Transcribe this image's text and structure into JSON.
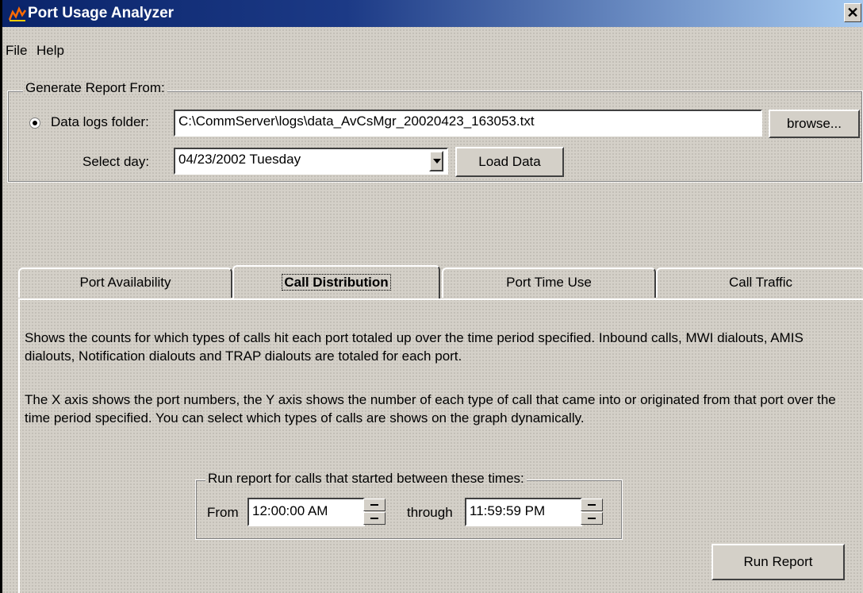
{
  "window": {
    "title": "Port Usage Analyzer",
    "close_glyph": "✕"
  },
  "menu": {
    "items": [
      "File",
      "Help"
    ]
  },
  "generate": {
    "legend": "Generate Report From:",
    "data_logs_label": "Data logs folder:",
    "data_logs_value": "C:\\CommServer\\logs\\data_AvCsMgr_20020423_163053.txt",
    "browse_label": "browse...",
    "select_day_label": "Select day:",
    "select_day_value": "04/23/2002 Tuesday",
    "load_data_label": "Load Data"
  },
  "tabs": [
    {
      "label": "Port Availability",
      "active": false
    },
    {
      "label": "Call Distribution",
      "active": true
    },
    {
      "label": "Port Time Use",
      "active": false
    },
    {
      "label": "Call Traffic",
      "active": false
    }
  ],
  "panel": {
    "desc1": "Shows the counts for which types of calls hit each port totaled up over the time period specified.  Inbound calls, MWI dialouts, AMIS dialouts, Notification dialouts and TRAP dialouts are totaled for each port.",
    "desc2": "The X axis shows the port numbers, the Y axis shows the number of each type of call that came into or originated from that port over the time period specified.  You can select which types of calls are shows on the graph dynamically.",
    "time_group_legend": "Run report for calls that started between these times:",
    "from_label": "From",
    "from_value": "12:00:00 AM",
    "through_label": "through",
    "through_value": "11:59:59 PM",
    "run_report_label": "Run Report"
  },
  "colors": {
    "title_gradient_start": "#0a246a",
    "title_gradient_end": "#a6caf0",
    "face": "#d4d0c8"
  }
}
